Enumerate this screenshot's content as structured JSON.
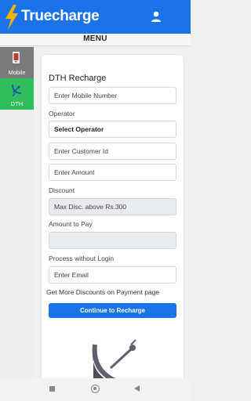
{
  "header": {
    "app_name": "Truecharge",
    "brand_color": "#1a73e8",
    "bolt_color": "#f5b400",
    "user_icon": "user-icon"
  },
  "menu": {
    "label": "MENU"
  },
  "sidebar": {
    "items": [
      {
        "label": "Mobile",
        "icon": "mobile-phone-icon",
        "active": false
      },
      {
        "label": "DTH",
        "icon": "satellite-dish-icon",
        "active": true,
        "active_color": "#2fbe5a"
      }
    ]
  },
  "form": {
    "title": "DTH Recharge",
    "mobile_placeholder": "Enter Mobile Number",
    "operator_label": "Operator",
    "operator_value": "Select Operator",
    "customer_id_placeholder": "Enter Customer Id",
    "amount_placeholder": "Enter Amount",
    "discount_label": "Discount",
    "discount_value": "Max Disc. above Rs.300",
    "amount_to_pay_label": "Amount to Pay",
    "amount_to_pay_value": "",
    "login_label": "Process without Login",
    "email_placeholder": "Enter Email",
    "discount_note": "Get More Discounts on Payment page",
    "submit_label": "Continue to Recharge"
  },
  "system_nav": {
    "icons": [
      "recent-apps-icon",
      "home-icon",
      "back-icon"
    ]
  }
}
